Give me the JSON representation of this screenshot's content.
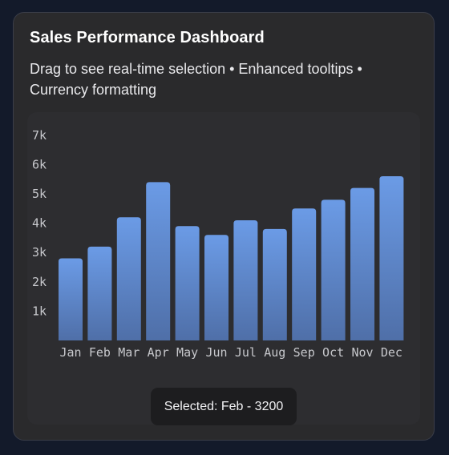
{
  "card": {
    "title": "Sales Performance Dashboard",
    "subtitle": "Drag to see real-time selection • Enhanced tooltips • Currency formatting"
  },
  "selection": {
    "text": "Selected: Feb - 3200",
    "category": "Feb",
    "value": 3200
  },
  "colors": {
    "bar_top": "#6b9be6",
    "bar_bottom": "#4f6fa8",
    "card_bg": "#2a2a2c",
    "page_bg": "#131a2a"
  },
  "chart_data": {
    "type": "bar",
    "categories": [
      "Jan",
      "Feb",
      "Mar",
      "Apr",
      "May",
      "Jun",
      "Jul",
      "Aug",
      "Sep",
      "Oct",
      "Nov",
      "Dec"
    ],
    "values": [
      2800,
      3200,
      4200,
      5400,
      3900,
      3600,
      4100,
      3800,
      4500,
      4800,
      5200,
      5600
    ],
    "yticks": [
      1000,
      2000,
      3000,
      4000,
      5000,
      6000,
      7000
    ],
    "ytick_labels": [
      "1k",
      "2k",
      "3k",
      "4k",
      "5k",
      "6k",
      "7k"
    ],
    "ylim": [
      0,
      7000
    ],
    "grid": false
  }
}
